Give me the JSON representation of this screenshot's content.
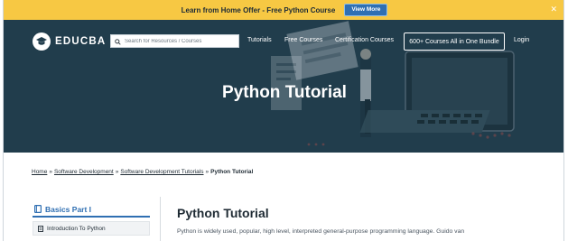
{
  "promo": {
    "text": "Learn from Home Offer - Free Python Course",
    "button": "View More",
    "close": "✕"
  },
  "nav": {
    "logo": "EDUCBA",
    "search_placeholder": "Search for Resources / Courses",
    "links": [
      "Tutorials",
      "Free Courses",
      "Certification Courses"
    ],
    "bundle": "600+ Courses All in One Bundle",
    "login": "Login"
  },
  "hero": {
    "title": "Python Tutorial"
  },
  "breadcrumb": {
    "items": [
      "Home",
      "Software Development",
      "Software Development Tutorials"
    ],
    "separator": "»",
    "current": "Python Tutorial"
  },
  "sidebar": {
    "section_title": "Basics Part I",
    "items": [
      {
        "label": "Introduction To Python"
      }
    ]
  },
  "main": {
    "title": "Python Tutorial",
    "intro": "Python is widely used, popular, high level, interpreted general-purpose programming language. Guido van"
  },
  "colors": {
    "promo_bg": "#f7c843",
    "hero_bg": "#213d4c",
    "accent": "#2f6fb2"
  },
  "icons": [
    "graduation-cap-logo-icon",
    "search-icon",
    "close-icon",
    "book-icon",
    "document-icon"
  ]
}
